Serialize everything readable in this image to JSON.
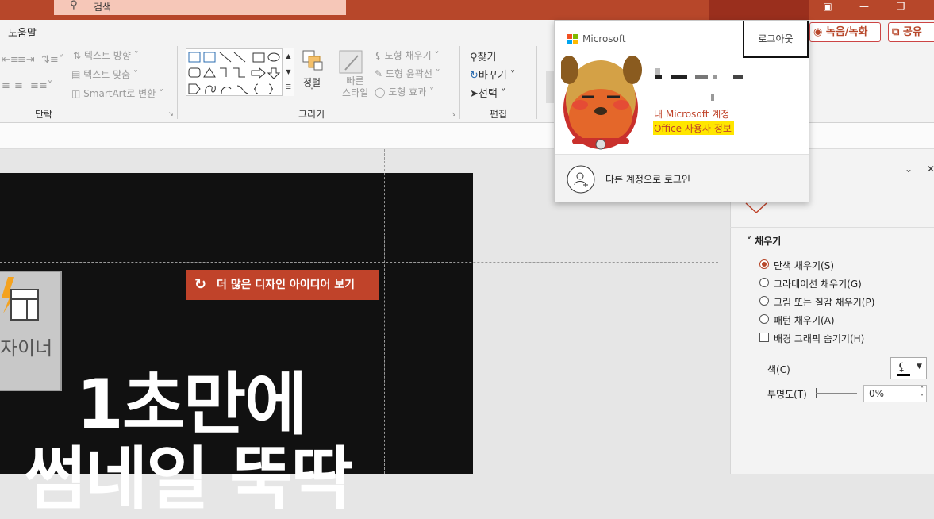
{
  "titlebar": {
    "search_placeholder": "검색",
    "icons": {
      "search": "search-icon",
      "window_mode": "window-mode-icon",
      "minimize": "minimize-icon",
      "restore": "restore-icon"
    },
    "colors": {
      "brand": "#b7472a",
      "search_bg": "#f6c7b8"
    }
  },
  "menu": {
    "help": "도움말"
  },
  "ribbon": {
    "paragraph": {
      "label": "단락",
      "text_direction": "텍스트 방향",
      "align_text": "텍스트 맞춤",
      "smartart": "SmartArt로 변환"
    },
    "drawing": {
      "label": "그리기",
      "arrange": "정렬",
      "quick_styles": "빠른\n스타일",
      "shape_fill": "도형 채우기",
      "shape_outline": "도형 윤곽선",
      "shape_effects": "도형 효과"
    },
    "editing": {
      "label": "편집",
      "find": "찾기",
      "replace": "바꾸기",
      "select": "선택"
    },
    "record": "녹음/녹화",
    "share": "공유"
  },
  "slide": {
    "design_ideas": "더 많은 디자인 아이디어 보기",
    "designer_label": "자이너",
    "title_line1": "1초만에",
    "title_line2": "썸네일 뚝딱"
  },
  "pane": {
    "fill_section": "채우기",
    "options": [
      {
        "label": "단색 채우기(S)",
        "selected": true
      },
      {
        "label": "그라데이션 채우기(G)",
        "selected": false
      },
      {
        "label": "그림 또는 질감 채우기(P)",
        "selected": false
      },
      {
        "label": "패턴 채우기(A)",
        "selected": false
      }
    ],
    "hide_bg": "배경 그래픽 숨기기(H)",
    "color_label": "색(C)",
    "transparency_label": "투명도(T)",
    "transparency_value": "0%"
  },
  "account_popup": {
    "brand": "Microsoft",
    "sign_out": "로그아웃",
    "my_account": "내 Microsoft 계정",
    "office_info": "Office 사용자 정보",
    "other_account": "다른 계정으로 로그인",
    "colors": {
      "link": "#c0432a",
      "highlight": "#ffe600"
    }
  }
}
